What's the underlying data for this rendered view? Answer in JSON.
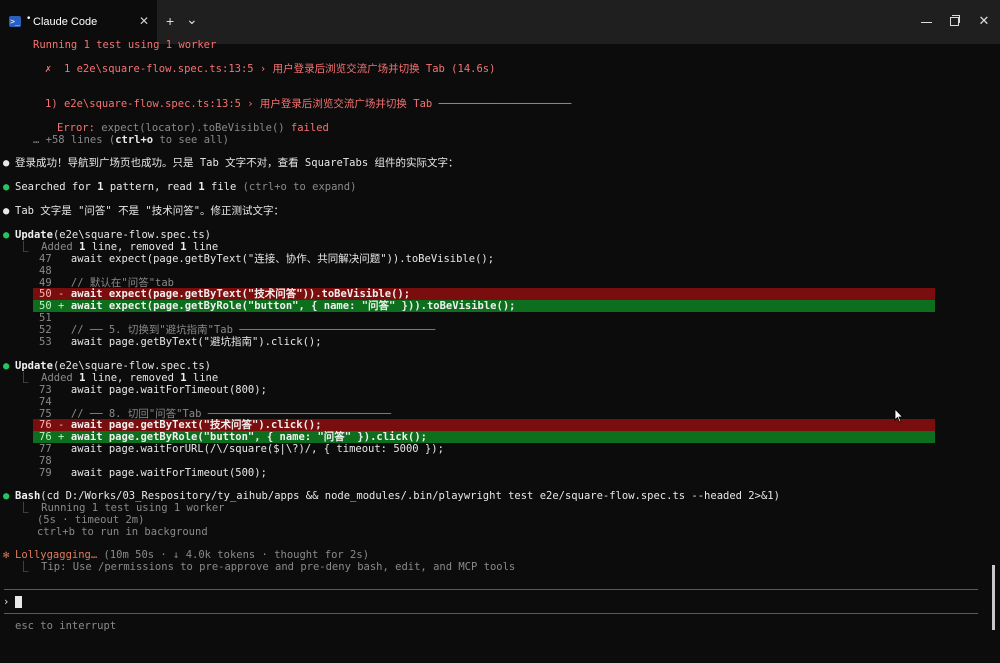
{
  "window": {
    "tab_title": "Claude Code",
    "tab_modified_dot": "•",
    "tab_close": "✕",
    "new_tab": "+",
    "dropdown": "⌄",
    "close": "✕"
  },
  "terminal": {
    "l1": "Running 1 test using 1 worker",
    "l2": "✗  1 e2e\\square-flow.spec.ts:13:5 › 用户登录后浏览交流广场并切换 Tab (14.6s)",
    "l3": "1) e2e\\square-flow.spec.ts:13:5 › 用户登录后浏览交流广场并切换 Tab ─────────────────────",
    "l4a": "Error: ",
    "l4b": "expect(locator).toBeVisible()",
    "l4c": " failed",
    "l5a": "… +58 lines (",
    "l5b": "ctrl+o",
    "l5c": " to see all)",
    "m1_bullet": "●",
    "m1": "登录成功！导航到广场页也成功。只是 Tab 文字不对，查看 SquareTabs 组件的实际文字：",
    "m2_bullet": "●",
    "m2a": "Searched for ",
    "m2b": "1",
    "m2c": " pattern, read ",
    "m2d": "1",
    "m2e": " file ",
    "m2f": "(ctrl+o to expand)",
    "m3_bullet": "●",
    "m3": "Tab 文字是 \"问答\" 不是 \"技术问答\"。修正测试文字：",
    "u1_bullet": "●",
    "u1_a": "Update",
    "u1_b": "(e2e\\square-flow.spec.ts)",
    "u1_sum_a": "⎿  Added ",
    "u1_sum_b": "1",
    "u1_sum_c": " line, removed ",
    "u1_sum_d": "1",
    "u1_sum_e": " line",
    "d1_47_no": "47",
    "d1_47_code": "      await expect(page.getByText(\"连接、协作、共同解决问题\")).toBeVisible();",
    "d1_48_no": "48",
    "d1_49_no": "49",
    "d1_49_code": "      // 默认在\"问答\"tab",
    "d1_50a_no": "50 -",
    "d1_50a_code": "      await expect(page.getByText(\"技术问答\")).toBeVisible();",
    "d1_50b_no": "50 +",
    "d1_50b_code": "      await expect(page.getByRole(\"button\", { name: \"问答\" })).toBeVisible();",
    "d1_51_no": "51",
    "d1_52_no": "52",
    "d1_52_code": "      // ── 5. 切换到\"避坑指南\"Tab ───────────────────────────────",
    "d1_53_no": "53",
    "d1_53_code": "      await page.getByText(\"避坑指南\").click();",
    "u2_bullet": "●",
    "u2_a": "Update",
    "u2_b": "(e2e\\square-flow.spec.ts)",
    "u2_sum_a": "⎿  Added ",
    "u2_sum_b": "1",
    "u2_sum_c": " line, removed ",
    "u2_sum_d": "1",
    "u2_sum_e": " line",
    "d2_73_no": "73",
    "d2_73_code": "      await page.waitForTimeout(800);",
    "d2_74_no": "74",
    "d2_75_no": "75",
    "d2_75_code": "      // ── 8. 切回\"问答\"Tab ─────────────────────────────",
    "d2_76a_no": "76 -",
    "d2_76a_code": "      await page.getByText(\"技术问答\").click();",
    "d2_76b_no": "76 +",
    "d2_76b_code": "      await page.getByRole(\"button\", { name: \"问答\" }).click();",
    "d2_77_no": "77",
    "d2_77_code": "      await page.waitForURL(/\\/square($|\\?)/, { timeout: 5000 });",
    "d2_78_no": "78",
    "d2_79_no": "79",
    "d2_79_code": "      await page.waitForTimeout(500);",
    "b_bullet": "●",
    "b_a": "Bash",
    "b_b": "(cd D:/Works/03_Respository/ty_aihub/apps && node_modules/.bin/playwright test e2e/square-flow.spec.ts --headed 2>&1)",
    "b_1": "⎿  Running 1 test using 1 worker",
    "b_2": "   (5s · timeout 2m)",
    "b_3": "   ctrl+b to run in background",
    "s_star": "✻",
    "s_a": "Lollygagging…",
    "s_b": " (10m 50s · ↓ 4.0k tokens · thought for 2s)",
    "s_tip": "⎿  Tip: Use /permissions to pre-approve and pre-deny bash, edit, and MCP tools",
    "prompt": "›",
    "footer": "esc to interrupt"
  },
  "colors": {
    "bg": "#0c0c0c",
    "error": "#f87272",
    "success": "#22c55e",
    "diff_removed": "#7a0e0e",
    "diff_added": "#0d6f1d",
    "spinner": "#e07b5a"
  }
}
